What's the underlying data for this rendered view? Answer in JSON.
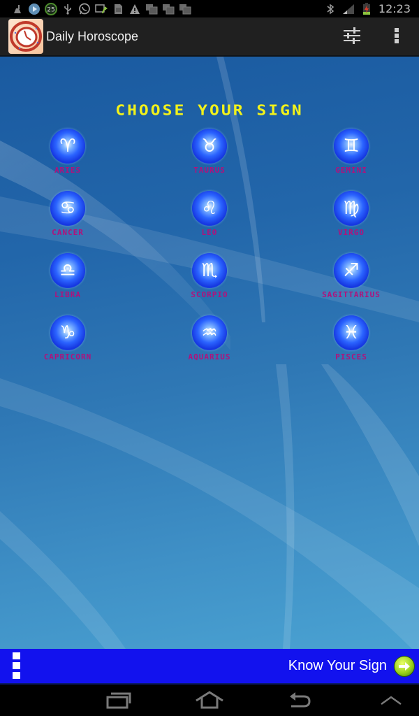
{
  "status_bar": {
    "notification_icons": [
      "cleaner-icon",
      "media-icon",
      "badge-25-icon",
      "usb-icon",
      "whatsapp-icon",
      "screen-share-icon",
      "sd-card-icon",
      "warning-icon",
      "gallery-icon",
      "gallery-icon",
      "gallery-icon"
    ],
    "badge_count": "25",
    "time": "12:23",
    "system_icons": [
      "bluetooth-icon",
      "signal-icon",
      "battery-charging-icon"
    ]
  },
  "action_bar": {
    "app_title": "Daily Horoscope",
    "actions": [
      "settings-sliders-icon",
      "overflow-menu-icon"
    ]
  },
  "main": {
    "heading": "CHOOSE YOUR SIGN",
    "signs": [
      {
        "label": "ARIES",
        "glyph": "♈"
      },
      {
        "label": "TAURUS",
        "glyph": "♉"
      },
      {
        "label": "GEMINI",
        "glyph": "♊"
      },
      {
        "label": "CANCER",
        "glyph": "♋"
      },
      {
        "label": "LEO",
        "glyph": "♌"
      },
      {
        "label": "VIRGO",
        "glyph": "♍"
      },
      {
        "label": "LIBRA",
        "glyph": "♎"
      },
      {
        "label": "SCORPIO",
        "glyph": "♏"
      },
      {
        "label": "SAGITTARIUS",
        "glyph": "♐"
      },
      {
        "label": "CAPRICORN",
        "glyph": "♑"
      },
      {
        "label": "AQUARIUS",
        "glyph": "♒"
      },
      {
        "label": "PISCES",
        "glyph": "♓"
      }
    ]
  },
  "bottom_bar": {
    "know_sign_label": "Know Your Sign"
  },
  "nav_bar": {
    "buttons": [
      "recent-apps",
      "home",
      "back",
      "up"
    ]
  },
  "colors": {
    "heading": "#f2f21a",
    "sign_label": "#b0127c",
    "bottom_bar": "#1212ee",
    "action_bar": "#202020"
  }
}
